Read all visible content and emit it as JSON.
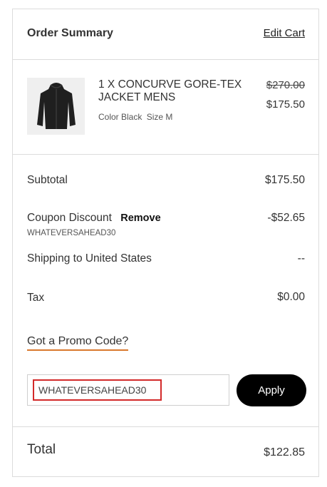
{
  "header": {
    "title": "Order Summary",
    "edit_cart": "Edit Cart"
  },
  "item": {
    "name": "1 X CONCURVE GORE-TEX JACKET MENS",
    "color_label": "Color Black",
    "size_label": "Size M",
    "original_price": "$270.00",
    "sale_price": "$175.50",
    "image_icon": "jacket-image"
  },
  "summary": {
    "subtotal_label": "Subtotal",
    "subtotal_value": "$175.50",
    "coupon_label": "Coupon Discount",
    "remove_label": "Remove",
    "coupon_code": "WHATEVERSAHEAD30",
    "coupon_value": "-$52.65",
    "shipping_label": "Shipping to United States",
    "shipping_value": "--",
    "tax_label": "Tax",
    "tax_value": "$0.00"
  },
  "promo": {
    "link_label": "Got a Promo Code?",
    "input_value": "WHATEVERSAHEAD30",
    "apply_label": "Apply",
    "accent_color": "#d9782d",
    "highlight_color": "#d32a2a"
  },
  "total": {
    "label": "Total",
    "value": "$122.85"
  }
}
